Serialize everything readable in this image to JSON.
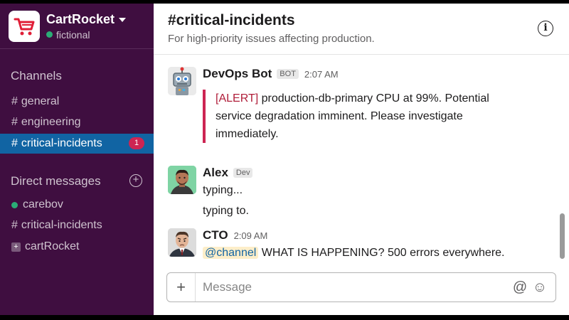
{
  "workspace": {
    "name": "CartRocket",
    "status": "fictional"
  },
  "sidebar": {
    "channels_title": "Channels",
    "channels": [
      {
        "label": "general"
      },
      {
        "label": "engineering"
      },
      {
        "label": "critical-incidents",
        "badge": "1",
        "active": true
      }
    ],
    "dm_title": "Direct messages",
    "dm_items": [
      {
        "label": "carebov"
      },
      {
        "label": "critical-incidents"
      },
      {
        "label": "cartRocket"
      }
    ]
  },
  "channel": {
    "title": "#critical-incidents",
    "topic": "For high-priority issues affecting production."
  },
  "messages": [
    {
      "author": "DevOps Bot",
      "tag": "BOT",
      "time": "2:07 AM",
      "alert_prefix": "[ALERT]",
      "alert_lines": [
        "production-db-primary CPU at 99%. Potential",
        "service degradation imminent. Please investigate",
        "immediately."
      ]
    },
    {
      "author": "Alex",
      "tag": "Dev",
      "lines": [
        "typing...",
        "typing to."
      ]
    },
    {
      "author": "CTO",
      "time": "2:09 AM",
      "mention": "@channel",
      "text": "WHAT IS HAPPENING? 500 errors everywhere."
    }
  ],
  "composer": {
    "placeholder": "Message",
    "add_symbol": "+"
  },
  "colors": {
    "sidebar": "#3f0e40",
    "active": "#1164a3",
    "alert": "#cd2553",
    "presence": "#2bac76"
  }
}
